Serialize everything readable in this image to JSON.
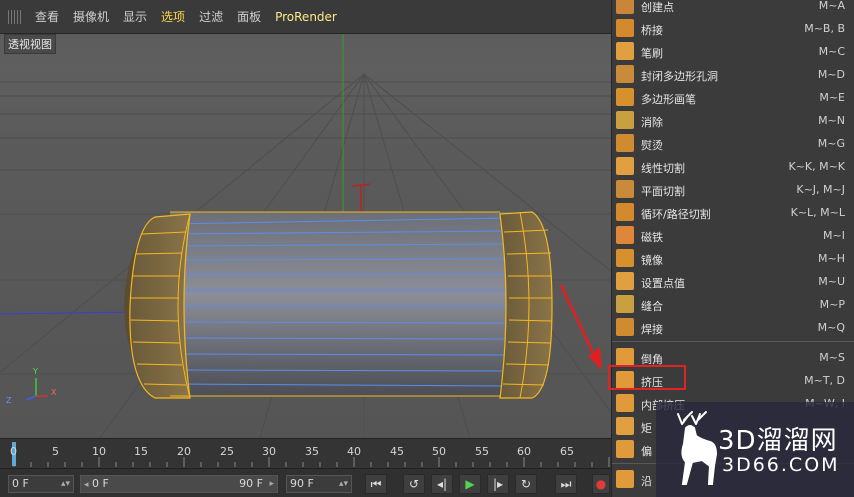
{
  "menubar": {
    "items": [
      "查看",
      "摄像机",
      "显示",
      "选项",
      "过滤",
      "面板",
      "ProRender"
    ],
    "active_item": "选项"
  },
  "viewport": {
    "label": "透视视图",
    "axis_labels": {
      "y": "Y",
      "z": "Z",
      "x": "X"
    }
  },
  "timeline": {
    "ticks": [
      "0",
      "5",
      "10",
      "15",
      "20",
      "25",
      "30",
      "35",
      "40",
      "45",
      "50",
      "55",
      "60",
      "65"
    ]
  },
  "transport": {
    "current_frame": "0 F",
    "range_start": "0 F",
    "range_end": "90 F",
    "end_frame": "90 F"
  },
  "context_menu": {
    "items": [
      {
        "label": "创建点",
        "shortcut": "M~A",
        "icon": "create-point-icon",
        "color": "#c9853a"
      },
      {
        "label": "桥接",
        "shortcut": "M~B, B",
        "icon": "bridge-icon",
        "color": "#d48a2c"
      },
      {
        "label": "笔刷",
        "shortcut": "M~C",
        "icon": "brush-icon",
        "color": "#e0a040"
      },
      {
        "label": "封闭多边形孔洞",
        "shortcut": "M~D",
        "icon": "close-hole-icon",
        "color": "#c98a3a"
      },
      {
        "label": "多边形画笔",
        "shortcut": "M~E",
        "icon": "polygon-pen-icon",
        "color": "#d8902c"
      },
      {
        "label": "消除",
        "shortcut": "M~N",
        "icon": "dissolve-icon",
        "color": "#c9a040"
      },
      {
        "label": "熨烫",
        "shortcut": "M~G",
        "icon": "iron-icon",
        "color": "#d08a30"
      },
      {
        "label": "线性切割",
        "shortcut": "K~K, M~K",
        "icon": "knife-line-icon",
        "color": "#e0a040"
      },
      {
        "label": "平面切割",
        "shortcut": "K~J, M~J",
        "icon": "knife-plane-icon",
        "color": "#c98a3a"
      },
      {
        "label": "循环/路径切割",
        "shortcut": "K~L, M~L",
        "icon": "loop-cut-icon",
        "color": "#d48a2c"
      },
      {
        "label": "磁铁",
        "shortcut": "M~I",
        "icon": "magnet-icon",
        "color": "#e0863a"
      },
      {
        "label": "镜像",
        "shortcut": "M~H",
        "icon": "mirror-icon",
        "color": "#d8902c"
      },
      {
        "label": "设置点值",
        "shortcut": "M~U",
        "icon": "set-point-icon",
        "color": "#e0a040"
      },
      {
        "label": "缝合",
        "shortcut": "M~P",
        "icon": "stitch-icon",
        "color": "#c9a040"
      },
      {
        "label": "焊接",
        "shortcut": "M~Q",
        "icon": "weld-icon",
        "color": "#d08a30"
      },
      {
        "label": "倒角",
        "shortcut": "M~S",
        "icon": "bevel-icon",
        "color": "#e09a3a"
      },
      {
        "label": "挤压",
        "shortcut": "M~T, D",
        "icon": "extrude-icon",
        "color": "#e09a3a"
      },
      {
        "label": "内部挤压",
        "shortcut": "M~W, I",
        "icon": "extrude-inner-icon",
        "color": "#e09a3a"
      },
      {
        "label": "矩",
        "shortcut": "",
        "icon": "matrix-extrude-icon",
        "color": "#e0a040"
      },
      {
        "label": "偏",
        "shortcut": "",
        "icon": "offset-icon",
        "color": "#e09a3a"
      },
      {
        "label": "沿",
        "shortcut": "",
        "icon": "sweep-icon",
        "color": "#e09a3a"
      }
    ]
  },
  "watermark": {
    "text1": "3D溜溜网",
    "text2": "3D66.COM"
  }
}
